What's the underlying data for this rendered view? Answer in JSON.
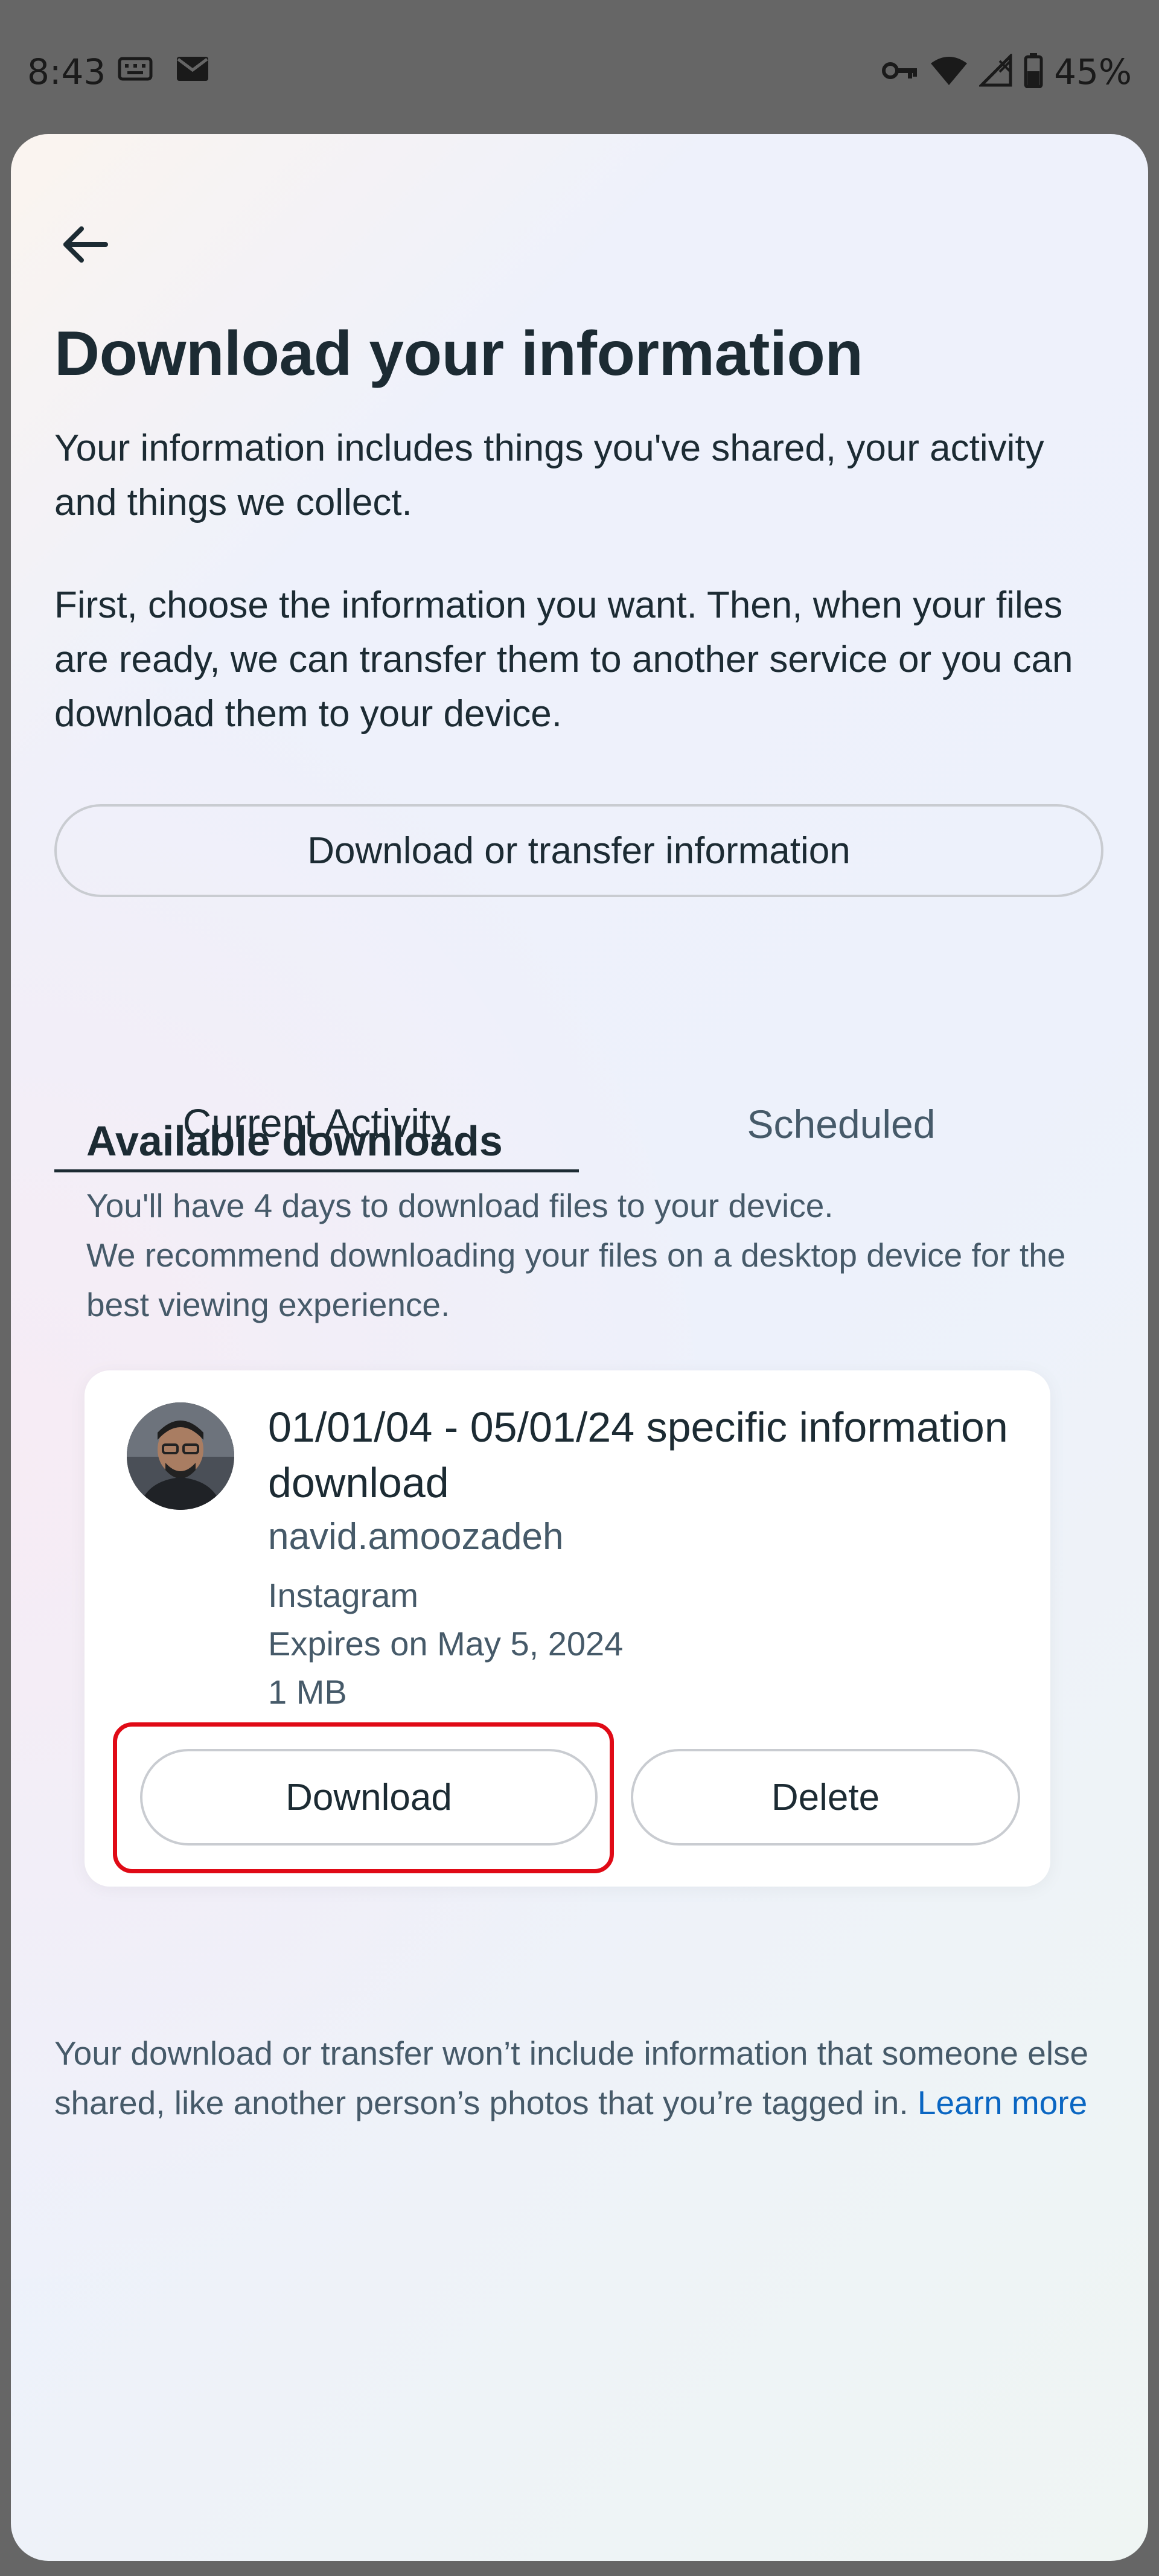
{
  "status_bar": {
    "time": "8:43",
    "battery": "45%",
    "left_icons": [
      "keyboard-icon",
      "mail-icon"
    ],
    "right_icons": [
      "vpn-key-icon",
      "wifi-icon",
      "signal-icon",
      "battery-icon"
    ]
  },
  "page": {
    "title": "Download your information",
    "intro_1": "Your information includes things you've shared, your activity and things we collect.",
    "intro_2": "First, choose the information you want. Then, when your files are ready, we can transfer them to another service or you can download them to your device.",
    "transfer_button": "Download or transfer information"
  },
  "tabs": [
    {
      "label": "Current Activity",
      "selected": true
    },
    {
      "label": "Scheduled",
      "selected": false
    }
  ],
  "available": {
    "title": "Available downloads",
    "desc_1": "You'll have 4 days to download files to your device.",
    "desc_2": "We recommend downloading your files on a desktop device for the best viewing experience."
  },
  "download_card": {
    "title": "01/01/04 - 05/01/24 specific information download",
    "username": "navid.amoozadeh",
    "source": "Instagram",
    "expiry": "Expires on May 5, 2024",
    "size": "1 MB",
    "download_label": "Download",
    "delete_label": "Delete"
  },
  "footer": {
    "note": "Your download or transfer won’t include information that someone else shared, like another person’s photos that you’re tagged in.",
    "learn_more": "Learn more"
  },
  "colors": {
    "text_primary": "#1c2b33",
    "text_secondary": "#465a69",
    "link": "#0a66c2",
    "highlight": "#e00a16",
    "scrim": "#666666"
  }
}
